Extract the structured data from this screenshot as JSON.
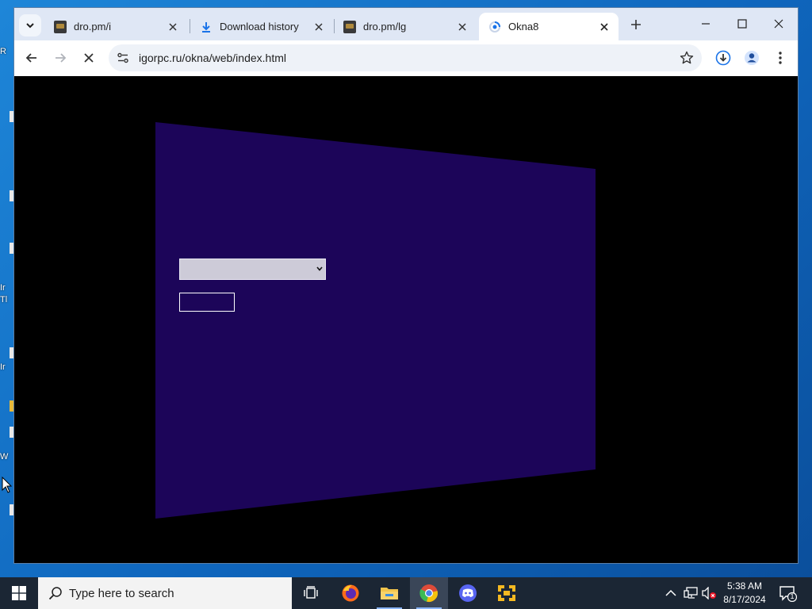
{
  "desktop": {
    "fragments": [
      "R",
      "Ir",
      "Tl",
      "Ir",
      "W"
    ]
  },
  "browser": {
    "tabs": [
      {
        "title": "dro.pm/i",
        "favicon": "site-favicon",
        "active": false
      },
      {
        "title": "Download history",
        "favicon": "download-icon",
        "active": false
      },
      {
        "title": "dro.pm/lg",
        "favicon": "site-favicon",
        "active": false
      },
      {
        "title": "Okna8",
        "favicon": "loading-spinner-icon",
        "active": true
      }
    ],
    "url": "igorpc.ru/okna/web/index.html",
    "page": {
      "panel_color": "#1c0559",
      "background": "#000000",
      "select_value": ""
    }
  },
  "taskbar": {
    "search_placeholder": "Type here to search",
    "apps": [
      "task-view",
      "firefox",
      "file-explorer",
      "chrome",
      "discord",
      "vmware"
    ],
    "clock_time": "5:38 AM",
    "clock_date": "8/17/2024",
    "notification_count": "1"
  },
  "colors": {
    "tabstrip": "#dfe7f5",
    "taskbar": "#1b2634",
    "accent": "#8ab4f8"
  }
}
